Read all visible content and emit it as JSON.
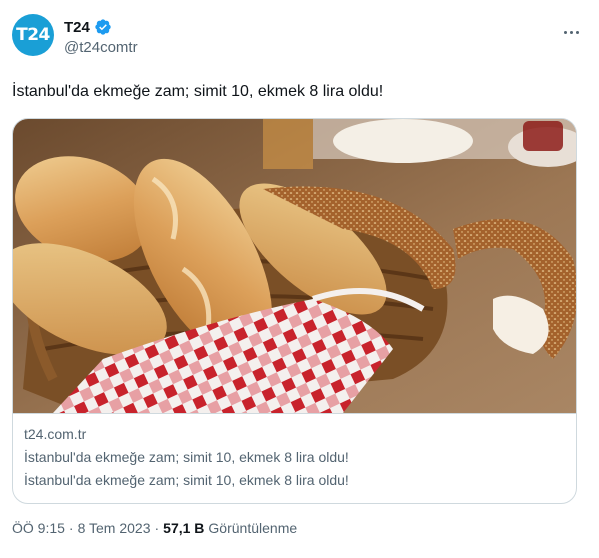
{
  "author": {
    "avatar_text": "T24",
    "display_name": "T24",
    "handle": "@t24comtr",
    "verified_icon": "verified-badge-icon",
    "avatar_color": "#1a9fd6",
    "badge_color": "#1d9bf0"
  },
  "tweet": {
    "text": "İstanbul'da ekmeğe zam; simit 10, ekmek 8 lira oldu!"
  },
  "card": {
    "image_alt": "bread-basket-photo",
    "domain": "t24.com.tr",
    "title": "İstanbul'da ekmeğe zam; simit 10, ekmek 8 lira oldu!",
    "description": "İstanbul'da ekmeğe zam; simit 10, ekmek 8 lira oldu!"
  },
  "meta": {
    "time": "ÖÖ 9:15",
    "separator1": "·",
    "date": "8 Tem 2023",
    "separator2": "·",
    "views_count": "57,1 B",
    "views_label": "Görüntülenme"
  }
}
